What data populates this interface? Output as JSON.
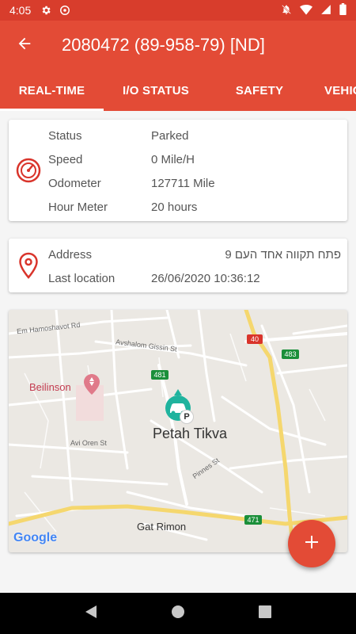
{
  "status_bar": {
    "time": "4:05",
    "icons": [
      "gear-icon",
      "at-icon",
      "mute-icon",
      "wifi-icon",
      "signal-icon",
      "battery-icon"
    ]
  },
  "app_bar": {
    "title": "2080472 (89-958-79) [ND]",
    "back_icon": "arrow-back-icon"
  },
  "tabs": [
    {
      "label": "REAL-TIME",
      "active": true
    },
    {
      "label": "I/O STATUS",
      "active": false
    },
    {
      "label": "SAFETY",
      "active": false
    },
    {
      "label": "VEHIC",
      "active": false
    }
  ],
  "vehicle_card": {
    "icon": "speedometer-icon",
    "rows": [
      {
        "label": "Status",
        "value": "Parked"
      },
      {
        "label": "Speed",
        "value": "0 Mile/H"
      },
      {
        "label": "Odometer",
        "value": "127711 Mile"
      },
      {
        "label": "Hour Meter",
        "value": "20 hours"
      }
    ]
  },
  "location_card": {
    "icon": "location-pin-icon",
    "rows": [
      {
        "label": "Address",
        "value": "פתח תקווה אחד העם 9"
      },
      {
        "label": "Last location",
        "value": "26/06/2020 10:36:12"
      }
    ]
  },
  "map": {
    "labels": {
      "street_1": "Em Hamoshavot Rd",
      "street_2": "Avshalom Gissin St",
      "street_3": "Avi Oren St",
      "street_4": "Pinnes St",
      "poi": "Beilinson",
      "city": "Petah Tikva",
      "area": "Gat Rimon",
      "provider": "Google"
    },
    "shields": {
      "r40": "40",
      "r483": "483",
      "r481": "481",
      "r471": "471"
    },
    "marker_badge": "P"
  },
  "fab": {
    "icon": "plus-icon"
  },
  "nav_bar": {
    "icons": [
      "back-triangle-icon",
      "home-circle-icon",
      "recents-square-icon"
    ]
  },
  "colors": {
    "primary": "#e34b36",
    "status_bar": "#d83d2c",
    "marker": "#1fb39e",
    "highway": "#f5d76e"
  }
}
